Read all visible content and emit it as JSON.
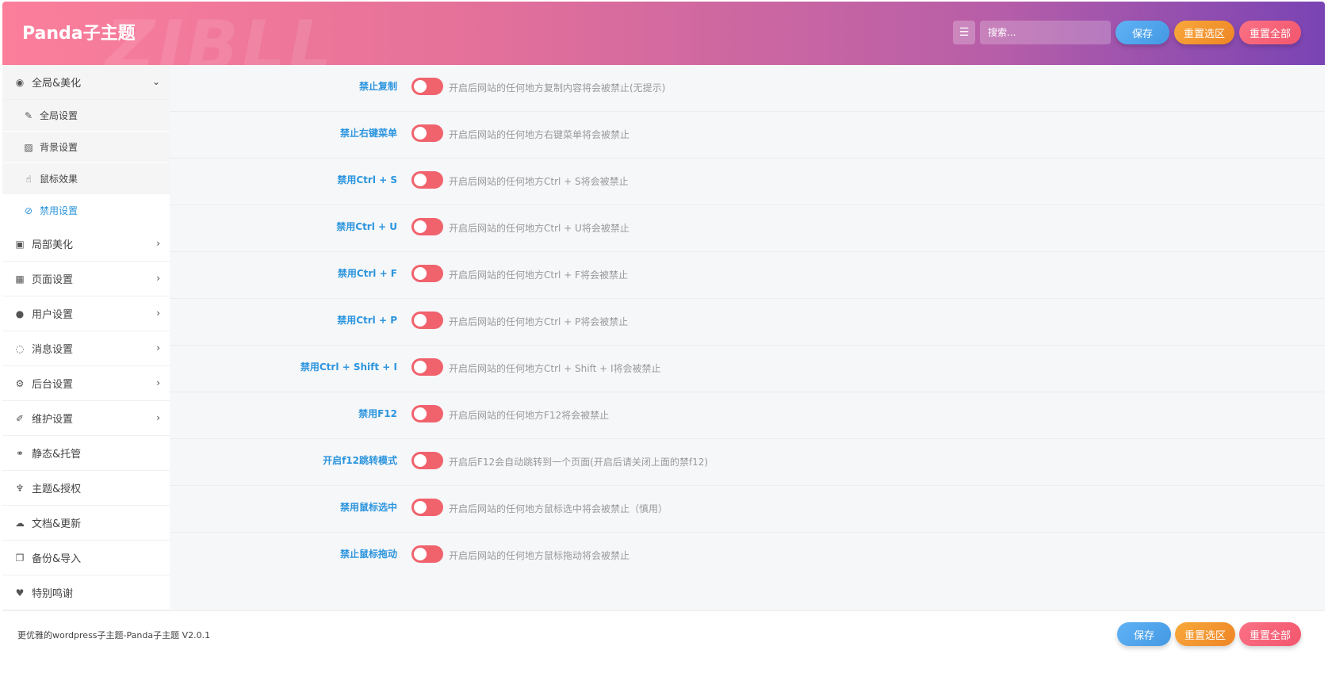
{
  "header": {
    "title": "Panda子主题",
    "watermark": "ZIBLL",
    "search_placeholder": "搜索...",
    "expand_icon": "expand-list-icon",
    "buttons": {
      "save": "保存",
      "reset_section": "重置选区",
      "reset_all": "重置全部"
    }
  },
  "sidebar": {
    "top": {
      "label": "全局&美化",
      "icon": "dot-circle-icon"
    },
    "sub": [
      {
        "label": "全局设置",
        "icon": "brush-icon"
      },
      {
        "label": "背景设置",
        "icon": "image-icon"
      },
      {
        "label": "鼠标效果",
        "icon": "pointer-hand-icon"
      },
      {
        "label": "禁用设置",
        "icon": "ban-icon"
      }
    ],
    "items": [
      {
        "label": "局部美化",
        "icon": "picture-frame-icon"
      },
      {
        "label": "页面设置",
        "icon": "calendar-icon"
      },
      {
        "label": "用户设置",
        "icon": "user-icon"
      },
      {
        "label": "消息设置",
        "icon": "chat-bubble-icon"
      },
      {
        "label": "后台设置",
        "icon": "gears-icon"
      },
      {
        "label": "维护设置",
        "icon": "wrench-icon"
      },
      {
        "label": "静态&托管",
        "icon": "handshake-icon"
      },
      {
        "label": "主题&授权",
        "icon": "fox-logo-icon"
      },
      {
        "label": "文档&更新",
        "icon": "cloud-download-icon"
      },
      {
        "label": "备份&导入",
        "icon": "copy-icon"
      },
      {
        "label": "特别鸣谢",
        "icon": "heart-icon"
      }
    ]
  },
  "settings": [
    {
      "label": "禁止复制",
      "desc": "开启后网站的任何地方复制内容将会被禁止(无提示)",
      "enabled": false
    },
    {
      "label": "禁止右键菜单",
      "desc": "开启后网站的任何地方右键菜单将会被禁止",
      "enabled": false
    },
    {
      "label": "禁用Ctrl + S",
      "desc": "开启后网站的任何地方Ctrl + S将会被禁止",
      "enabled": false
    },
    {
      "label": "禁用Ctrl + U",
      "desc": "开启后网站的任何地方Ctrl + U将会被禁止",
      "enabled": false
    },
    {
      "label": "禁用Ctrl + F",
      "desc": "开启后网站的任何地方Ctrl + F将会被禁止",
      "enabled": false
    },
    {
      "label": "禁用Ctrl + P",
      "desc": "开启后网站的任何地方Ctrl + P将会被禁止",
      "enabled": false
    },
    {
      "label": "禁用Ctrl + Shift + I",
      "desc": "开启后网站的任何地方Ctrl + Shift + I将会被禁止",
      "enabled": false
    },
    {
      "label": "禁用F12",
      "desc": "开启后网站的任何地方F12将会被禁止",
      "enabled": false
    },
    {
      "label": "开启f12跳转模式",
      "desc": "开启后F12会自动跳转到一个页面(开启后请关闭上面的禁f12)",
      "enabled": false
    },
    {
      "label": "禁用鼠标选中",
      "desc": "开启后网站的任何地方鼠标选中将会被禁止（慎用）",
      "enabled": false
    },
    {
      "label": "禁止鼠标拖动",
      "desc": "开启后网站的任何地方鼠标拖动将会被禁止",
      "enabled": false
    }
  ],
  "footer": {
    "credit": "更优雅的wordpress子主题-Panda子主题 V2.0.1",
    "buttons": {
      "save": "保存",
      "reset_section": "重置选区",
      "reset_all": "重置全部"
    }
  },
  "colors": {
    "accent": "#2c95de",
    "toggle_off": "#f0636d",
    "header_start": "#fb7f9b",
    "header_end": "#7a44b4"
  }
}
